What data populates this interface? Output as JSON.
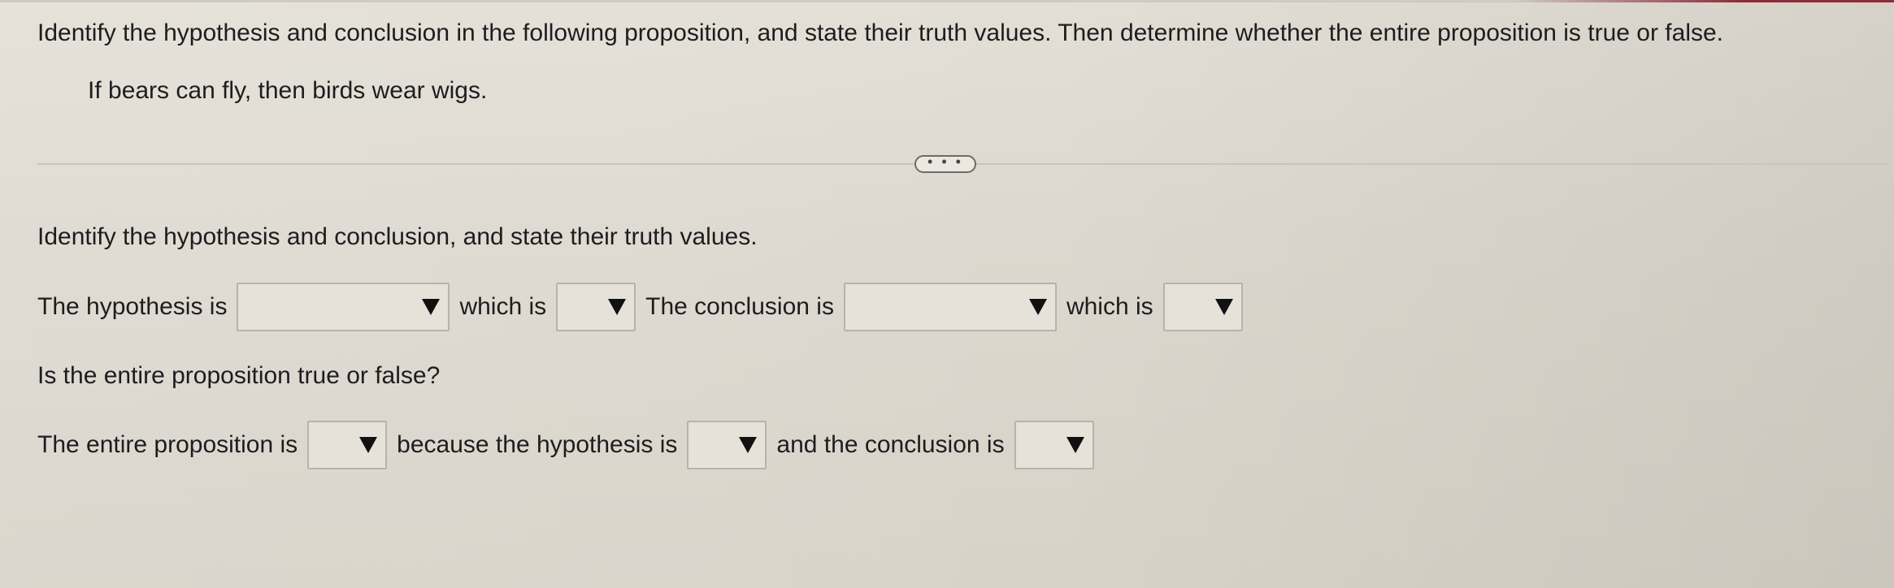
{
  "instructions": "Identify the hypothesis and conclusion in the following proposition, and state their truth values. Then determine whether the entire proposition is true or false.",
  "proposition": "If bears can fly, then birds wear wigs.",
  "more_button": {
    "label": "• • •",
    "icon": "ellipsis-icon"
  },
  "section_title": "Identify the hypothesis and conclusion, and state their truth values.",
  "row1": {
    "hypothesis_label": "The hypothesis is",
    "which_is_1": "which is",
    "conclusion_label": "The conclusion is",
    "which_is_2": "which is",
    "hypothesis_select_value": "",
    "hypothesis_truth_value": "",
    "conclusion_select_value": "",
    "conclusion_truth_value": ""
  },
  "question": "Is the entire proposition true or false?",
  "row3": {
    "entire_label": "The entire proposition is",
    "because_label": "because the hypothesis is",
    "and_label": "and the conclusion is",
    "entire_value": "",
    "because_value": "",
    "and_value": ""
  },
  "colors": {
    "background": "#ddd8cf",
    "text": "#1d1d1f",
    "accent_top": "#8b2d3a"
  }
}
